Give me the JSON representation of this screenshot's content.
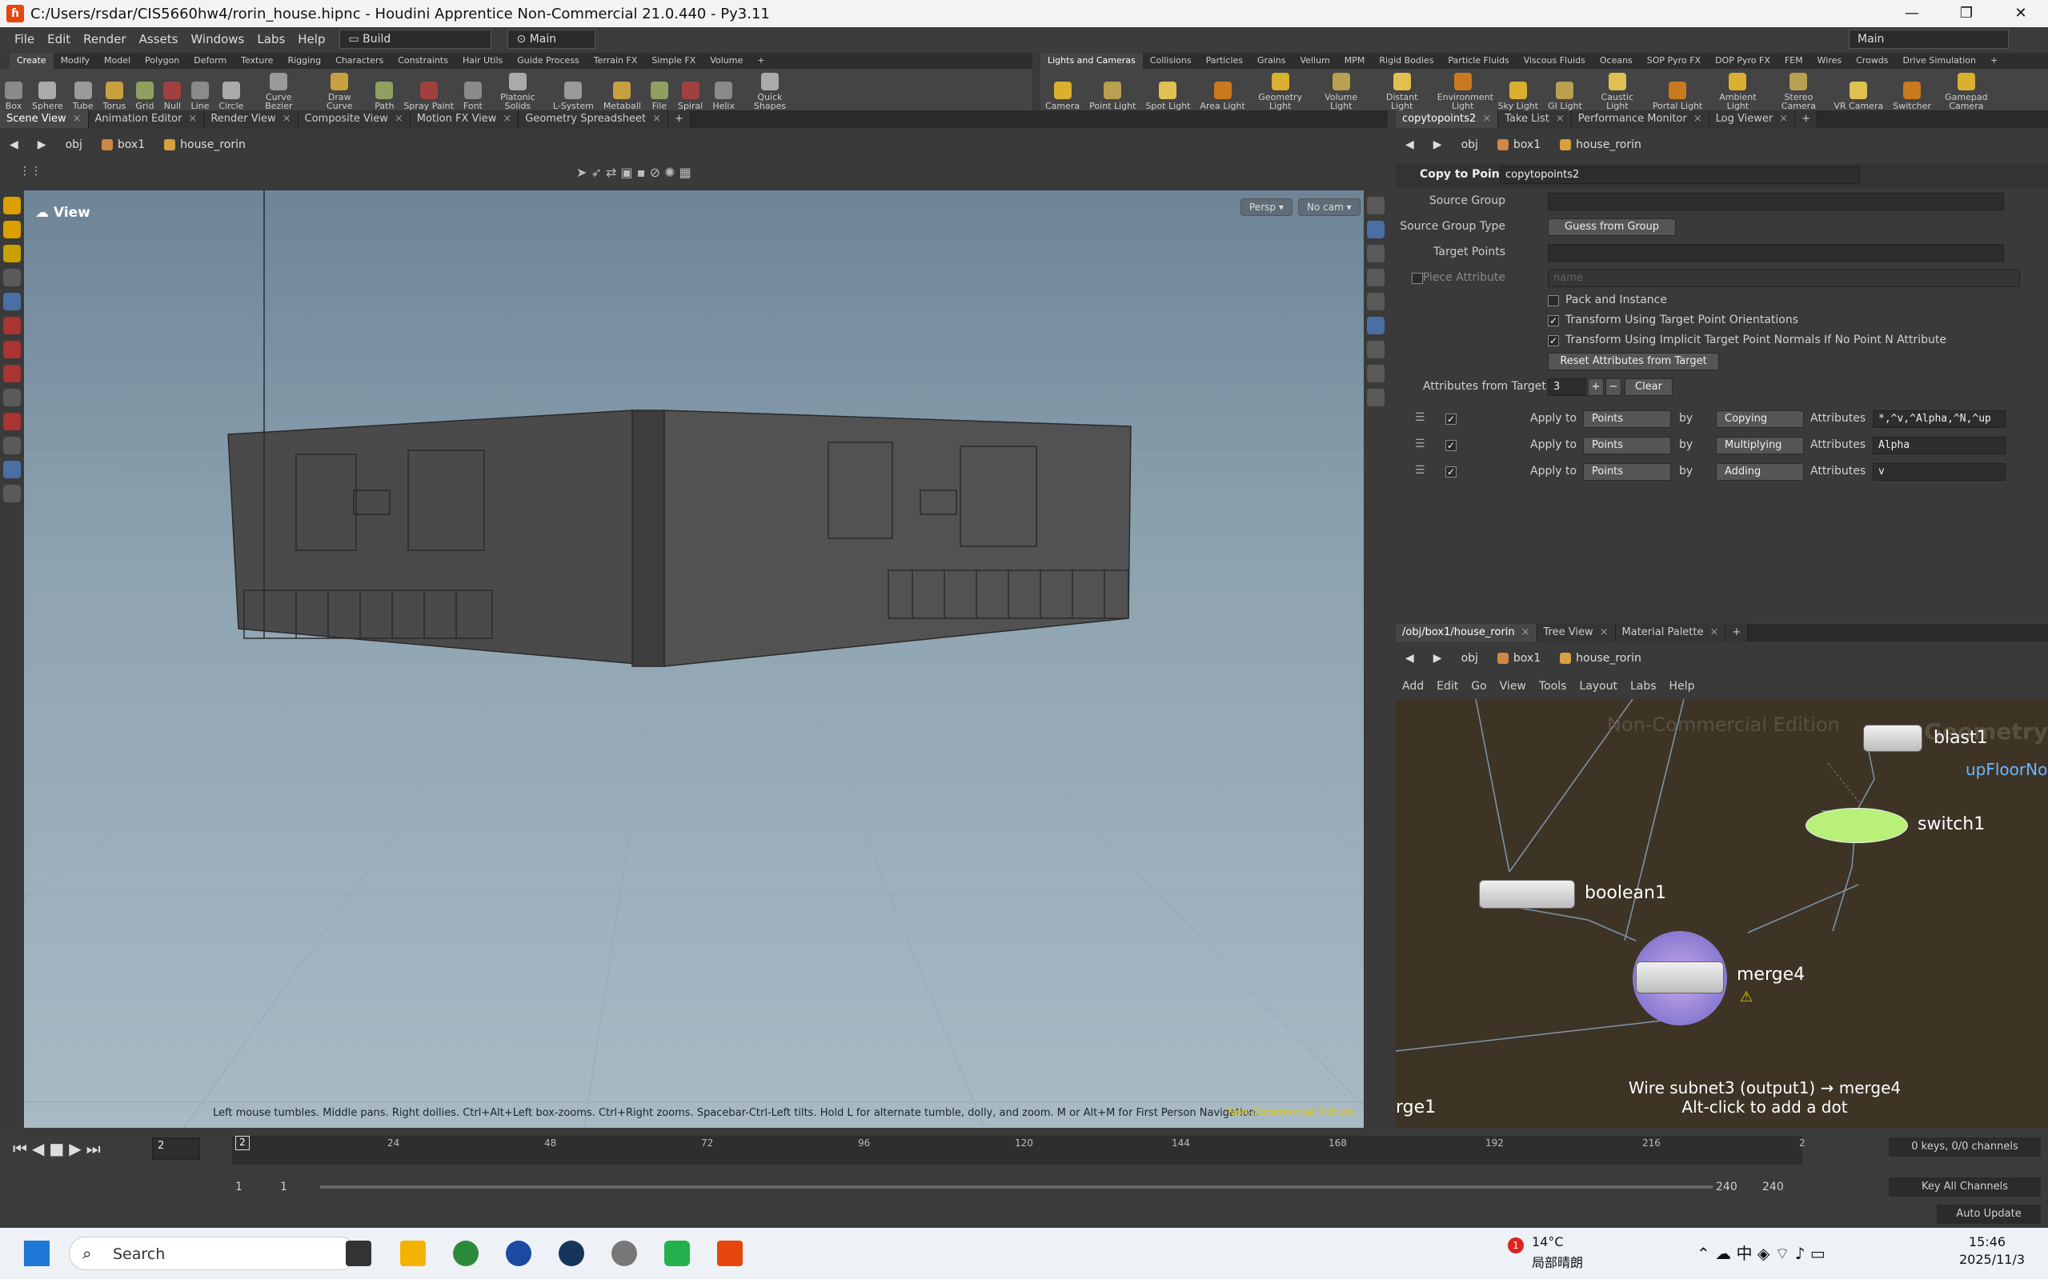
{
  "window": {
    "title": "C:/Users/rsdar/CIS5660hw4/rorin_house.hipnc - Houdini Apprentice Non-Commercial 21.0.440 - Py3.11",
    "controls": [
      "—",
      "❐",
      "✕"
    ]
  },
  "menu": {
    "items": [
      "File",
      "Edit",
      "Render",
      "Assets",
      "Windows",
      "Labs",
      "Help"
    ],
    "desk": "Build",
    "main": "Main",
    "right_main": "Main"
  },
  "shelf_left": {
    "tabs": [
      "Create",
      "Modify",
      "Model",
      "Polygon",
      "Deform",
      "Texture",
      "Rigging",
      "Characters",
      "Constraints",
      "Hair Utils",
      "Guide Process",
      "Terrain FX",
      "Simple FX",
      "Volume"
    ],
    "tools": [
      "Box",
      "Sphere",
      "Tube",
      "Torus",
      "Grid",
      "Null",
      "Line",
      "Circle",
      "Curve Bezier",
      "Draw Curve",
      "Path",
      "Spray Paint",
      "Font",
      "Platonic Solids",
      "L-System",
      "Metaball",
      "File",
      "Spiral",
      "Helix",
      "Quick Shapes"
    ]
  },
  "shelf_right": {
    "tabs": [
      "Lights and Cameras",
      "Collisions",
      "Particles",
      "Grains",
      "Vellum",
      "MPM",
      "Rigid Bodies",
      "Particle Fluids",
      "Viscous Fluids",
      "Oceans",
      "SOP Pyro FX",
      "DOP Pyro FX",
      "FEM",
      "Wires",
      "Crowds",
      "Drive Simulation"
    ],
    "tools": [
      "Camera",
      "Point Light",
      "Spot Light",
      "Area Light",
      "Geometry Light",
      "Volume Light",
      "Distant Light",
      "Environment Light",
      "Sky Light",
      "GI Light",
      "Caustic Light",
      "Portal Light",
      "Ambient Light",
      "Stereo Camera",
      "VR Camera",
      "Switcher",
      "Gamepad Camera"
    ]
  },
  "left_tabs": [
    "Scene View",
    "Animation Editor",
    "Render View",
    "Composite View",
    "Motion FX View",
    "Geometry Spreadsheet"
  ],
  "right_tabs": [
    "copytopoints2",
    "Take List",
    "Performance Monitor",
    "Log Viewer"
  ],
  "path": {
    "obj": "obj",
    "box": "box1",
    "node": "house_rorin"
  },
  "viewport": {
    "label": "View",
    "persp": "Persp",
    "cam": "No cam",
    "hint": "Left mouse tumbles. Middle pans. Right dollies. Ctrl+Alt+Left box-zooms. Ctrl+Right zooms. Spacebar-Ctrl-Left tilts. Hold L for alternate tumble, dolly, and zoom. M or Alt+M for First Person Navigation.",
    "watermark": "Non-Commercial Edition"
  },
  "params": {
    "op_type": "Copy to Points",
    "op_name": "copytopoints2",
    "source_group": "Source Group",
    "source_group_type": "Source Group Type",
    "sgt_value": "Guess from Group",
    "target_points": "Target Points",
    "piece_attr": "Piece Attribute",
    "piece_placeholder": "name",
    "pack": "Pack and Instance",
    "orient": "Transform Using Target Point Orientations",
    "implicit": "Transform Using Implicit Target Point Normals If No Point N Attribute",
    "reset": "Reset Attributes from Target",
    "attrs_label": "Attributes from Target",
    "attrs_count": "3",
    "clear": "Clear",
    "rows": [
      {
        "apply": "Apply to",
        "to": "Points",
        "by": "by",
        "mode": "Copying",
        "alabel": "Attributes",
        "attr": "*,^v,^Alpha,^N,^up"
      },
      {
        "apply": "Apply to",
        "to": "Points",
        "by": "by",
        "mode": "Multiplying",
        "alabel": "Attributes",
        "attr": "Alpha"
      },
      {
        "apply": "Apply to",
        "to": "Points",
        "by": "by",
        "mode": "Adding",
        "alabel": "Attributes",
        "attr": "v"
      }
    ]
  },
  "network": {
    "tabs": [
      "/obj/box1/house_rorin",
      "Tree View",
      "Material Palette"
    ],
    "menu": [
      "Add",
      "Edit",
      "Go",
      "View",
      "Tools",
      "Layout",
      "Labs",
      "Help"
    ],
    "watermark": "Non-Commercial Edition",
    "partial_label": "Geometry",
    "nodes": {
      "blast": "blast1",
      "upfloor": "upFloorNo",
      "switch": "switch1",
      "boolean": "boolean1",
      "merge": "merge4",
      "merge_partial": "rge1"
    },
    "tip1": "Wire subnet3 (output1) → merge4",
    "tip2": "Alt-click to add a dot"
  },
  "timeline": {
    "frame": "2",
    "ticks": [
      "24",
      "48",
      "72",
      "96",
      "120",
      "144",
      "168",
      "192",
      "216",
      "2"
    ],
    "start1": "1",
    "start2": "1",
    "end1": "240",
    "end2": "240",
    "keys": "0 keys, 0/0 channels",
    "key_all": "Key All Channels",
    "auto": "Auto Update"
  },
  "taskbar": {
    "search": "Search",
    "temp": "14°C",
    "weather": "局部晴朗",
    "time": "15:46",
    "date": "2025/11/3",
    "badge": "1"
  }
}
